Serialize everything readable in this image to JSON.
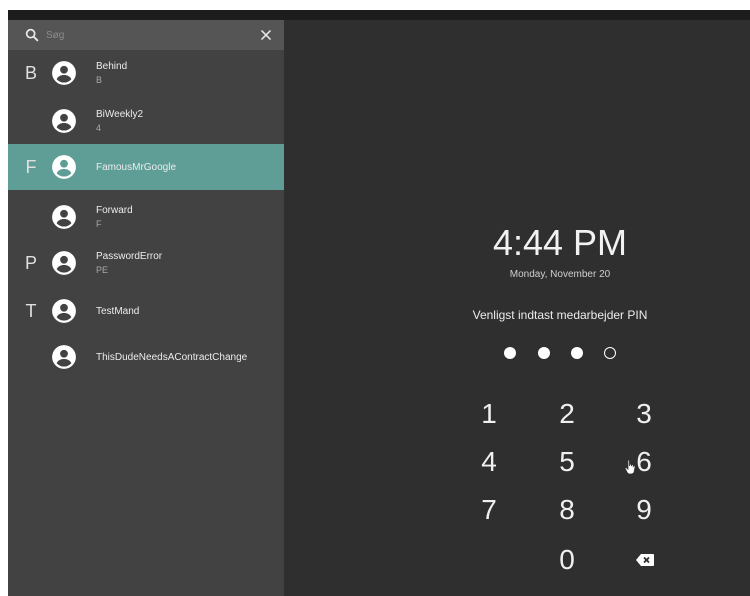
{
  "search": {
    "placeholder": "Søg"
  },
  "users": [
    {
      "letter": "B",
      "name": "Behind",
      "sub": "B",
      "selected": false
    },
    {
      "letter": "",
      "name": "BiWeekly2",
      "sub": "4",
      "selected": false
    },
    {
      "letter": "F",
      "name": "FamousMrGoogle",
      "sub": "",
      "selected": true
    },
    {
      "letter": "",
      "name": "Forward",
      "sub": "F",
      "selected": false
    },
    {
      "letter": "P",
      "name": "PasswordError",
      "sub": "PE",
      "selected": false
    },
    {
      "letter": "T",
      "name": "TestMand",
      "sub": "",
      "selected": false
    },
    {
      "letter": "",
      "name": "ThisDudeNeedsAContractChange",
      "sub": "",
      "selected": false
    }
  ],
  "clock": {
    "time": "4:44 PM",
    "date": "Monday, November 20"
  },
  "pin": {
    "prompt": "Venligst indtast medarbejder PIN",
    "entered": 3,
    "length": 4
  },
  "keypad": [
    "1",
    "2",
    "3",
    "4",
    "5",
    "6",
    "7",
    "8",
    "9",
    "0"
  ],
  "colors": {
    "selected_row": "#5e9e96",
    "sidebar": "#424242",
    "background": "#2f2f2f"
  },
  "icons": {
    "search": "search-icon",
    "clear": "close-icon",
    "avatar": "account-circle-icon",
    "backspace": "backspace-icon"
  }
}
